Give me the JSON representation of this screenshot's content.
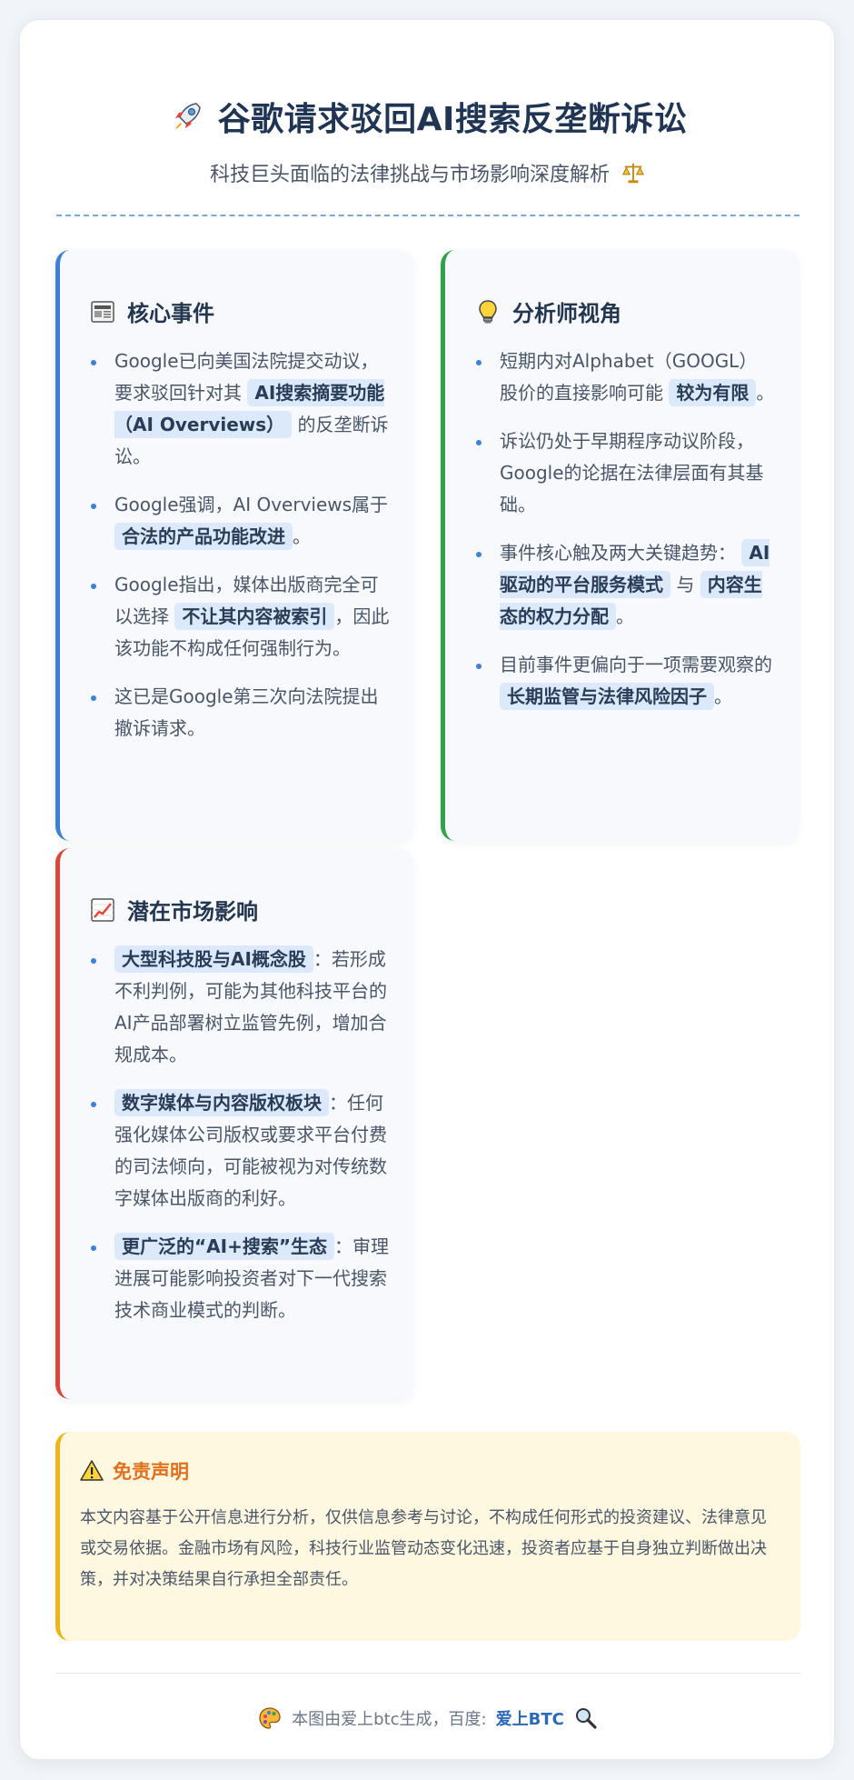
{
  "header": {
    "title": "谷歌请求驳回AI搜索反垄断诉讼",
    "subtitle": "科技巨头面临的法律挑战与市场影响深度解析",
    "title_icon": "rocket-icon",
    "subtitle_icon": "scales-icon"
  },
  "core": {
    "title": "核心事件",
    "icon": "newspaper-icon",
    "items": [
      {
        "pre": "Google已向美国法院提交动议，要求驳回针对其 ",
        "hl": "AI搜索摘要功能（AI Overviews）",
        "post": " 的反垄断诉讼。"
      },
      {
        "pre": "Google强调，AI Overviews属于 ",
        "hl": "合法的产品功能改进",
        "post": "。"
      },
      {
        "pre": "Google指出，媒体出版商完全可以选择 ",
        "hl": "不让其内容被索引",
        "post": "，因此该功能不构成任何强制行为。"
      },
      {
        "pre": "这已是Google第三次向法院提出撤诉请求。",
        "hl": "",
        "post": ""
      }
    ]
  },
  "analyst": {
    "title": "分析师视角",
    "icon": "lightbulb-icon",
    "items": [
      {
        "pre": "短期内对Alphabet（GOOGL）股价的直接影响可能 ",
        "hl": "较为有限",
        "post": "。"
      },
      {
        "pre": "诉讼仍处于早期程序动议阶段，Google的论据在法律层面有其基础。",
        "hl": "",
        "post": ""
      },
      {
        "pre": "事件核心触及两大关键趋势： ",
        "hl": "AI驱动的平台服务模式",
        "mid": " 与 ",
        "hl2": "内容生态的权力分配",
        "post": "。"
      },
      {
        "pre": "目前事件更偏向于一项需要观察的 ",
        "hl": "长期监管与法律风险因子",
        "post": "。"
      }
    ]
  },
  "market": {
    "title": "潜在市场影响",
    "icon": "chart-up-icon",
    "items": [
      {
        "pre": "",
        "hl": "大型科技股与AI概念股",
        "post": "：若形成不利判例，可能为其他科技平台的AI产品部署树立监管先例，增加合规成本。"
      },
      {
        "pre": "",
        "hl": "数字媒体与内容版权板块",
        "post": "：任何强化媒体公司版权或要求平台付费的司法倾向，可能被视为对传统数字媒体出版商的利好。"
      },
      {
        "pre": "",
        "hl": "更广泛的“AI+搜索”生态",
        "post": "：审理进展可能影响投资者对下一代搜索技术商业模式的判断。"
      }
    ]
  },
  "disclaimer": {
    "title": "免责声明",
    "icon": "warning-icon",
    "body": "本文内容基于公开信息进行分析，仅供信息参考与讨论，不构成任何形式的投资建议、法律意见或交易依据。金融市场有风险，科技行业监管动态变化迅速，投资者应基于自身独立判断做出决策，并对决策结果自行承担全部责任。"
  },
  "footer": {
    "text": "本图由爱上btc生成，百度:",
    "brand": "爱上BTC",
    "left_icon": "palette-icon",
    "right_icon": "magnifier-icon"
  },
  "colors": {
    "accent_blue": "#3b82d6",
    "accent_green": "#2fa24a",
    "accent_red": "#d9473f",
    "accent_yellow": "#f2b21a",
    "highlight_bg": "#dbe9fb",
    "title": "#1f3553"
  }
}
